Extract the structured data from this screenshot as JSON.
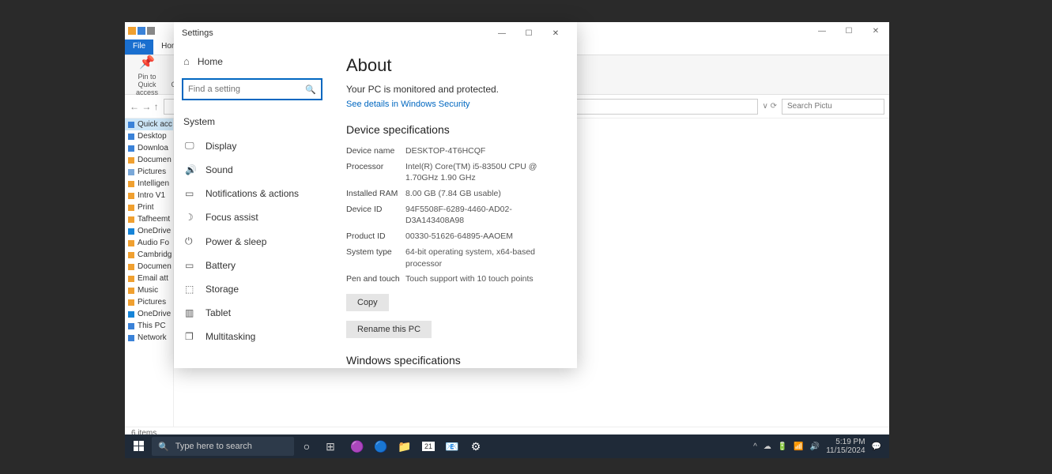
{
  "file_explorer": {
    "tabs": {
      "file": "File",
      "home": "Home"
    },
    "ribbon": {
      "pin": "Pin to Quick access",
      "copy": "Copy"
    },
    "search_placeholder": "Search Pictu",
    "sidebar": [
      {
        "label": "Quick acc",
        "color": "#3a82d8"
      },
      {
        "label": "Desktop",
        "color": "#3a82d8"
      },
      {
        "label": "Downloa",
        "color": "#3a82d8"
      },
      {
        "label": "Documen",
        "color": "#f0a030"
      },
      {
        "label": "Pictures",
        "color": "#7aa8d8"
      },
      {
        "label": "Intelligen",
        "color": "#f0a030"
      },
      {
        "label": "Intro V1",
        "color": "#f0a030"
      },
      {
        "label": "Print",
        "color": "#f0a030"
      },
      {
        "label": "Tafheemt",
        "color": "#f0a030"
      },
      {
        "label": "OneDrive",
        "color": "#1684d8"
      },
      {
        "label": "Audio Fo",
        "color": "#f0a030"
      },
      {
        "label": "Cambridg",
        "color": "#f0a030"
      },
      {
        "label": "Documen",
        "color": "#f0a030"
      },
      {
        "label": "Email att",
        "color": "#f0a030"
      },
      {
        "label": "Music",
        "color": "#f0a030"
      },
      {
        "label": "Pictures",
        "color": "#f0a030"
      },
      {
        "label": "OneDrive",
        "color": "#1684d8"
      },
      {
        "label": "This PC",
        "color": "#3a82d8"
      },
      {
        "label": "Network",
        "color": "#3a82d8"
      }
    ],
    "status": "6 items"
  },
  "settings": {
    "title": "Settings",
    "home": "Home",
    "search_placeholder": "Find a setting",
    "category": "System",
    "nav": [
      {
        "icon": "display",
        "label": "Display"
      },
      {
        "icon": "sound",
        "label": "Sound"
      },
      {
        "icon": "notif",
        "label": "Notifications & actions"
      },
      {
        "icon": "focus",
        "label": "Focus assist"
      },
      {
        "icon": "power",
        "label": "Power & sleep"
      },
      {
        "icon": "battery",
        "label": "Battery"
      },
      {
        "icon": "storage",
        "label": "Storage"
      },
      {
        "icon": "tablet",
        "label": "Tablet"
      },
      {
        "icon": "multi",
        "label": "Multitasking"
      }
    ],
    "about": {
      "title": "About",
      "protected": "Your PC is monitored and protected.",
      "security_link": "See details in Windows Security",
      "device_spec_header": "Device specifications",
      "specs": [
        {
          "k": "Device name",
          "v": "DESKTOP-4T6HCQF"
        },
        {
          "k": "Processor",
          "v": "Intel(R) Core(TM) i5-8350U CPU @ 1.70GHz   1.90 GHz"
        },
        {
          "k": "Installed RAM",
          "v": "8.00 GB (7.84 GB usable)"
        },
        {
          "k": "Device ID",
          "v": "94F5508F-6289-4460-AD02-D3A143408A98"
        },
        {
          "k": "Product ID",
          "v": "00330-51626-64895-AAOEM"
        },
        {
          "k": "System type",
          "v": "64-bit operating system, x64-based processor"
        },
        {
          "k": "Pen and touch",
          "v": "Touch support with 10 touch points"
        }
      ],
      "copy_btn": "Copy",
      "rename_btn": "Rename this PC",
      "win_spec_header": "Windows specifications"
    }
  },
  "taskbar": {
    "search": "Type here to search",
    "time": "5:19 PM",
    "date": "11/15/2024"
  }
}
